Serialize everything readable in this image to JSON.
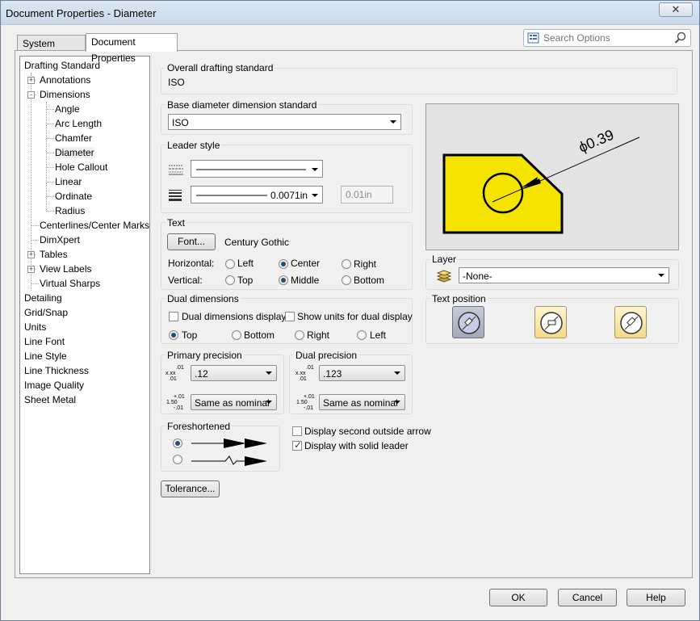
{
  "window": {
    "title": "Document Properties - Diameter",
    "close_glyph": "✕"
  },
  "tabs": [
    {
      "label": "System Options",
      "active": false
    },
    {
      "label": "Document Properties",
      "active": true
    }
  ],
  "search": {
    "placeholder": "Search Options",
    "icon": "search-icon"
  },
  "tree": [
    {
      "label": "Drafting Standard",
      "level": 0
    },
    {
      "label": "Annotations",
      "level": 1,
      "expander": "+"
    },
    {
      "label": "Dimensions",
      "level": 1,
      "expander": "-"
    },
    {
      "label": "Angle",
      "level": 2
    },
    {
      "label": "Arc Length",
      "level": 2
    },
    {
      "label": "Chamfer",
      "level": 2
    },
    {
      "label": "Diameter",
      "level": 2,
      "selected": true
    },
    {
      "label": "Hole Callout",
      "level": 2
    },
    {
      "label": "Linear",
      "level": 2
    },
    {
      "label": "Ordinate",
      "level": 2
    },
    {
      "label": "Radius",
      "level": 2
    },
    {
      "label": "Centerlines/Center Marks",
      "level": 1
    },
    {
      "label": "DimXpert",
      "level": 1
    },
    {
      "label": "Tables",
      "level": 1,
      "expander": "+"
    },
    {
      "label": "View Labels",
      "level": 1,
      "expander": "+"
    },
    {
      "label": "Virtual Sharps",
      "level": 1
    },
    {
      "label": "Detailing",
      "level": 0
    },
    {
      "label": "Grid/Snap",
      "level": 0
    },
    {
      "label": "Units",
      "level": 0
    },
    {
      "label": "Line Font",
      "level": 0
    },
    {
      "label": "Line Style",
      "level": 0
    },
    {
      "label": "Line Thickness",
      "level": 0
    },
    {
      "label": "Image Quality",
      "level": 0
    },
    {
      "label": "Sheet Metal",
      "level": 0
    }
  ],
  "overall": {
    "label": "Overall drafting standard",
    "value": "ISO"
  },
  "base_standard": {
    "label": "Base diameter dimension standard",
    "value": "ISO"
  },
  "leader_style": {
    "label": "Leader style",
    "thickness": "0.0071in",
    "custom_thickness": "0.01in"
  },
  "text": {
    "label": "Text",
    "font_button": "Font...",
    "font_name": "Century Gothic",
    "horizontal_label": "Horizontal:",
    "vertical_label": "Vertical:",
    "horizontal": [
      "Left",
      "Center",
      "Right"
    ],
    "horizontal_selected": "Center",
    "vertical": [
      "Top",
      "Middle",
      "Bottom"
    ],
    "vertical_selected": "Middle"
  },
  "dual": {
    "label": "Dual dimensions",
    "display_label": "Dual dimensions display",
    "display_checked": false,
    "units_label": "Show units for dual display",
    "units_checked": false,
    "positions": [
      "Top",
      "Bottom",
      "Right",
      "Left"
    ],
    "position_selected": "Top"
  },
  "primary_precision": {
    "label": "Primary precision",
    "value": ".12",
    "tolerance": "Same as nominal"
  },
  "dual_precision": {
    "label": "Dual precision",
    "value": ".123",
    "tolerance": "Same as nominal"
  },
  "precision_icons": {
    "value_top": ".01",
    "value_x": "x.xx",
    "value_bot": ".01",
    "tol_num": "1.50",
    "tol_top": "+.01",
    "tol_bot": "-.01"
  },
  "foreshortened": {
    "label": "Foreshortened",
    "selected_index": 0
  },
  "display_second_arrow": {
    "label": "Display second outside arrow",
    "checked": false
  },
  "solid_leader": {
    "label": "Display with solid leader",
    "checked": true
  },
  "tolerance_button": "Tolerance...",
  "preview": {
    "dimension_text": "ϕ0.39",
    "part_color": "#f5e400"
  },
  "layer": {
    "label": "Layer",
    "value": "-None-"
  },
  "text_position": {
    "label": "Text position",
    "selected_index": 0
  },
  "buttons": {
    "ok": "OK",
    "cancel": "Cancel",
    "help": "Help"
  }
}
